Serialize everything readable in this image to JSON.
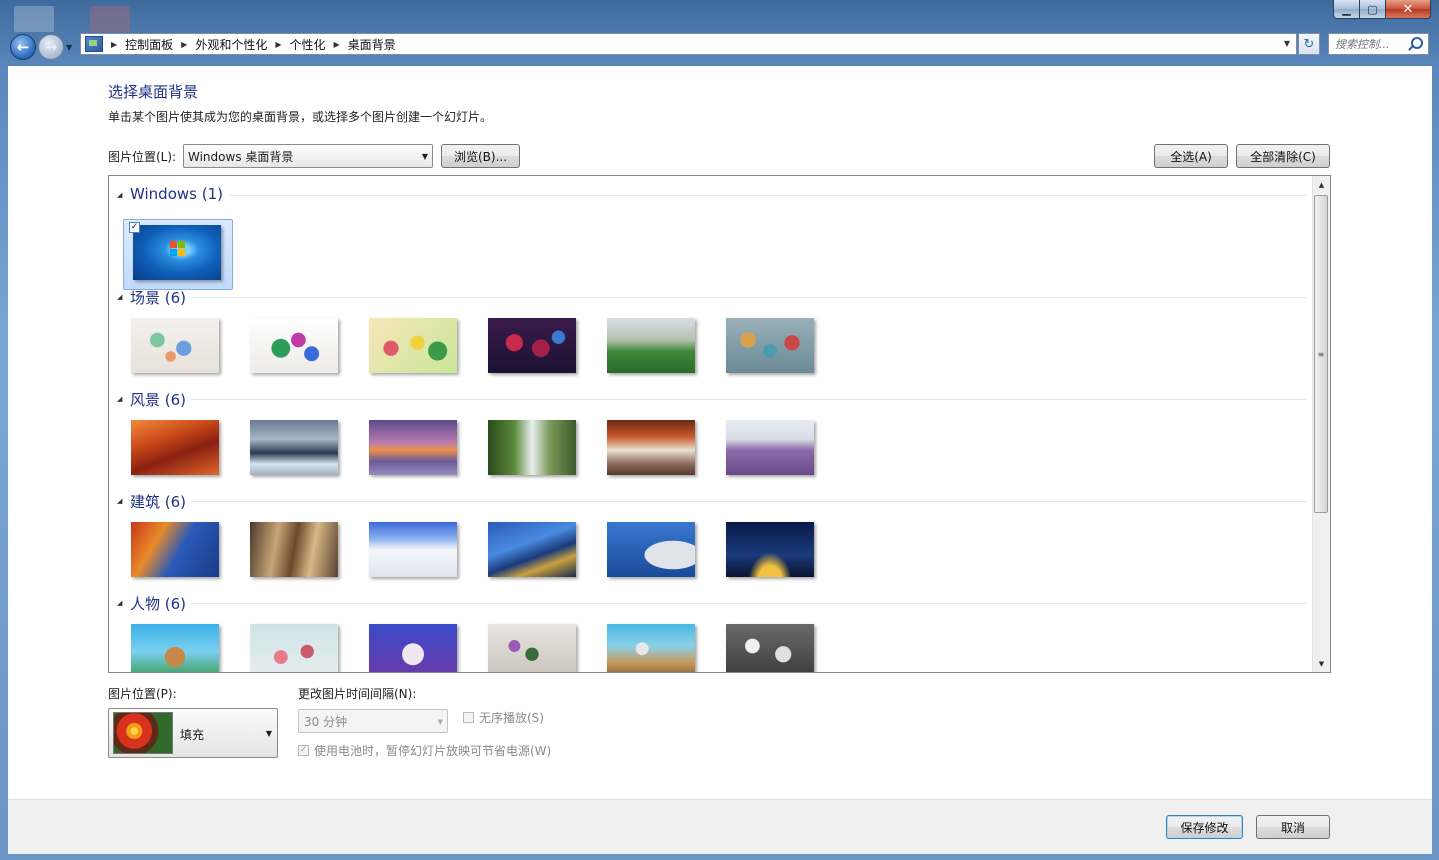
{
  "window": {
    "caption_buttons": {
      "minimize": "▁",
      "maximize": "▢",
      "close": "✕"
    }
  },
  "nav": {
    "back_icon": "back-arrow-icon",
    "forward_icon": "forward-arrow-icon",
    "breadcrumb": [
      "控制面板",
      "外观和个性化",
      "个性化",
      "桌面背景"
    ],
    "search_placeholder": "搜索控制..."
  },
  "page": {
    "heading": "选择桌面背景",
    "subtext": "单击某个图片使其成为您的桌面背景，或选择多个图片创建一个幻灯片。",
    "location_label": "图片位置(L):",
    "location_value": "Windows 桌面背景",
    "browse_label": "浏览(B)...",
    "select_all_label": "全选(A)",
    "clear_all_label": "全部清除(C)"
  },
  "gallery": {
    "groups": [
      {
        "title": "Windows (1)",
        "count": 1
      },
      {
        "title": "场景 (6)",
        "count": 6
      },
      {
        "title": "风景 (6)",
        "count": 6
      },
      {
        "title": "建筑 (6)",
        "count": 6
      },
      {
        "title": "人物 (6)",
        "count": 6
      }
    ],
    "selected": {
      "group": "Windows (1)",
      "index": 0,
      "checked": true
    }
  },
  "options": {
    "position_label": "图片位置(P):",
    "position_value": "填充",
    "interval_label": "更改图片时间间隔(N):",
    "interval_value": "30 分钟",
    "shuffle_label": "无序播放(S)",
    "shuffle_checked": false,
    "battery_label": "使用电池时，暂停幻灯片放映可节省电源(W)",
    "battery_checked": true
  },
  "footer": {
    "save_label": "保存修改",
    "cancel_label": "取消"
  }
}
